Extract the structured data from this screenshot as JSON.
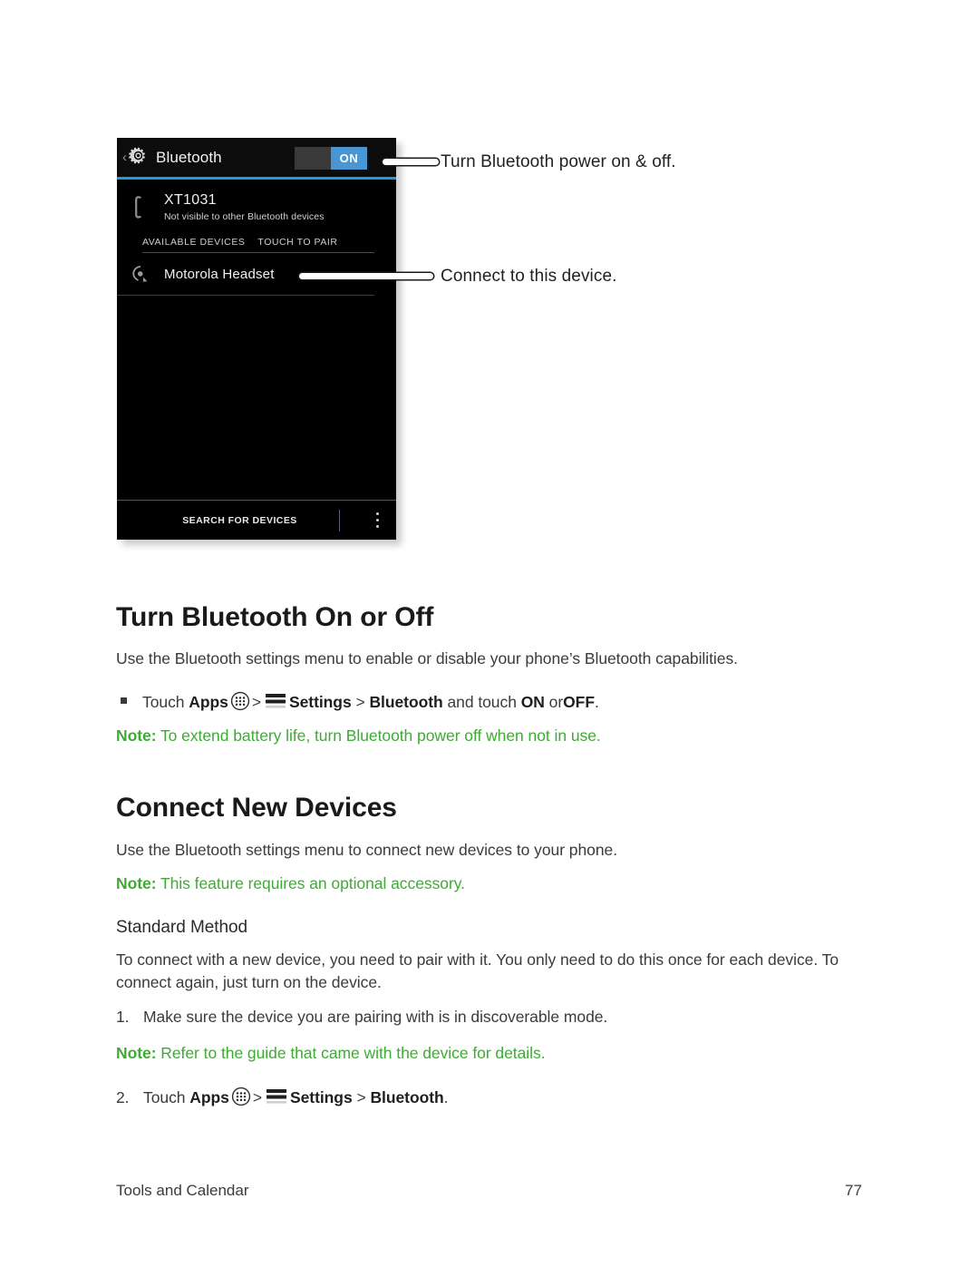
{
  "figure": {
    "phone_screen": {
      "actionbar": {
        "back_chevron": "‹",
        "gear_icon_name": "gear-icon",
        "title": "Bluetooth",
        "toggle": {
          "state_label": "ON",
          "on_color": "#4897d4",
          "off_color": "#3a3a3a"
        },
        "accent_color": "#1e9ed4"
      },
      "my_device": {
        "name": "XT1031",
        "subtitle": "Not visible to other Bluetooth devices",
        "icon_name": "phone-handset-icon"
      },
      "available_section": {
        "header_left": "AVAILABLE DEVICES",
        "header_right": "TOUCH TO PAIR",
        "devices": [
          {
            "name": "Motorola Headset",
            "icon_name": "bluetooth-headset-icon"
          }
        ]
      },
      "bottombar": {
        "search_label": "SEARCH FOR DEVICES",
        "overflow_icon_name": "overflow-menu-icon"
      }
    },
    "callouts": [
      {
        "label": "Turn Bluetooth power on & off."
      },
      {
        "label": "Connect to this device."
      }
    ]
  },
  "content": {
    "section_turn_bluetooth": {
      "heading": "Turn Bluetooth On or Off",
      "intro": "Use the Bluetooth settings menu to enable or disable your phone’s Bluetooth capabilities.",
      "bullet": {
        "touch": "Touch",
        "apps": "Apps",
        "sep1": ">",
        "settings": "Settings",
        "sep2": ">",
        "bluetooth": "Bluetooth",
        "and_touch": "and touch",
        "on": "ON",
        "or": "or",
        "off": "OFF",
        "period": "."
      },
      "note": {
        "label": "Note:",
        "text": "To extend battery life, turn Bluetooth power off when not in use."
      }
    },
    "section_connect_new": {
      "heading": "Connect New Devices",
      "intro": "Use the Bluetooth settings menu to connect new devices to your phone.",
      "note": {
        "label": "Note:",
        "text": "This feature requires an optional accessory."
      },
      "subheading": "Standard Method",
      "explain_line1": "To connect with a new device, you need to pair with it. You only need to do this once for each device.",
      "explain_line2": "To connect again, just turn on the device.",
      "step1": {
        "number": "1.",
        "text": "Make sure the device you are pairing with is in discoverable mode."
      },
      "note2": {
        "label": "Note:",
        "text": "Refer to the guide that came with the device for details."
      },
      "step2": {
        "number": "2.",
        "touch": "Touch",
        "apps": "Apps",
        "sep1": ">",
        "settings": "Settings",
        "sep2": ">",
        "bluetooth": "Bluetooth",
        "period": "."
      }
    }
  },
  "footer": {
    "section_name": "Tools and Calendar",
    "page_number": "77"
  },
  "colors": {
    "note_green": "#3faa35",
    "android_blue": "#4897d4",
    "accent_rule": "#1e9ed4"
  }
}
